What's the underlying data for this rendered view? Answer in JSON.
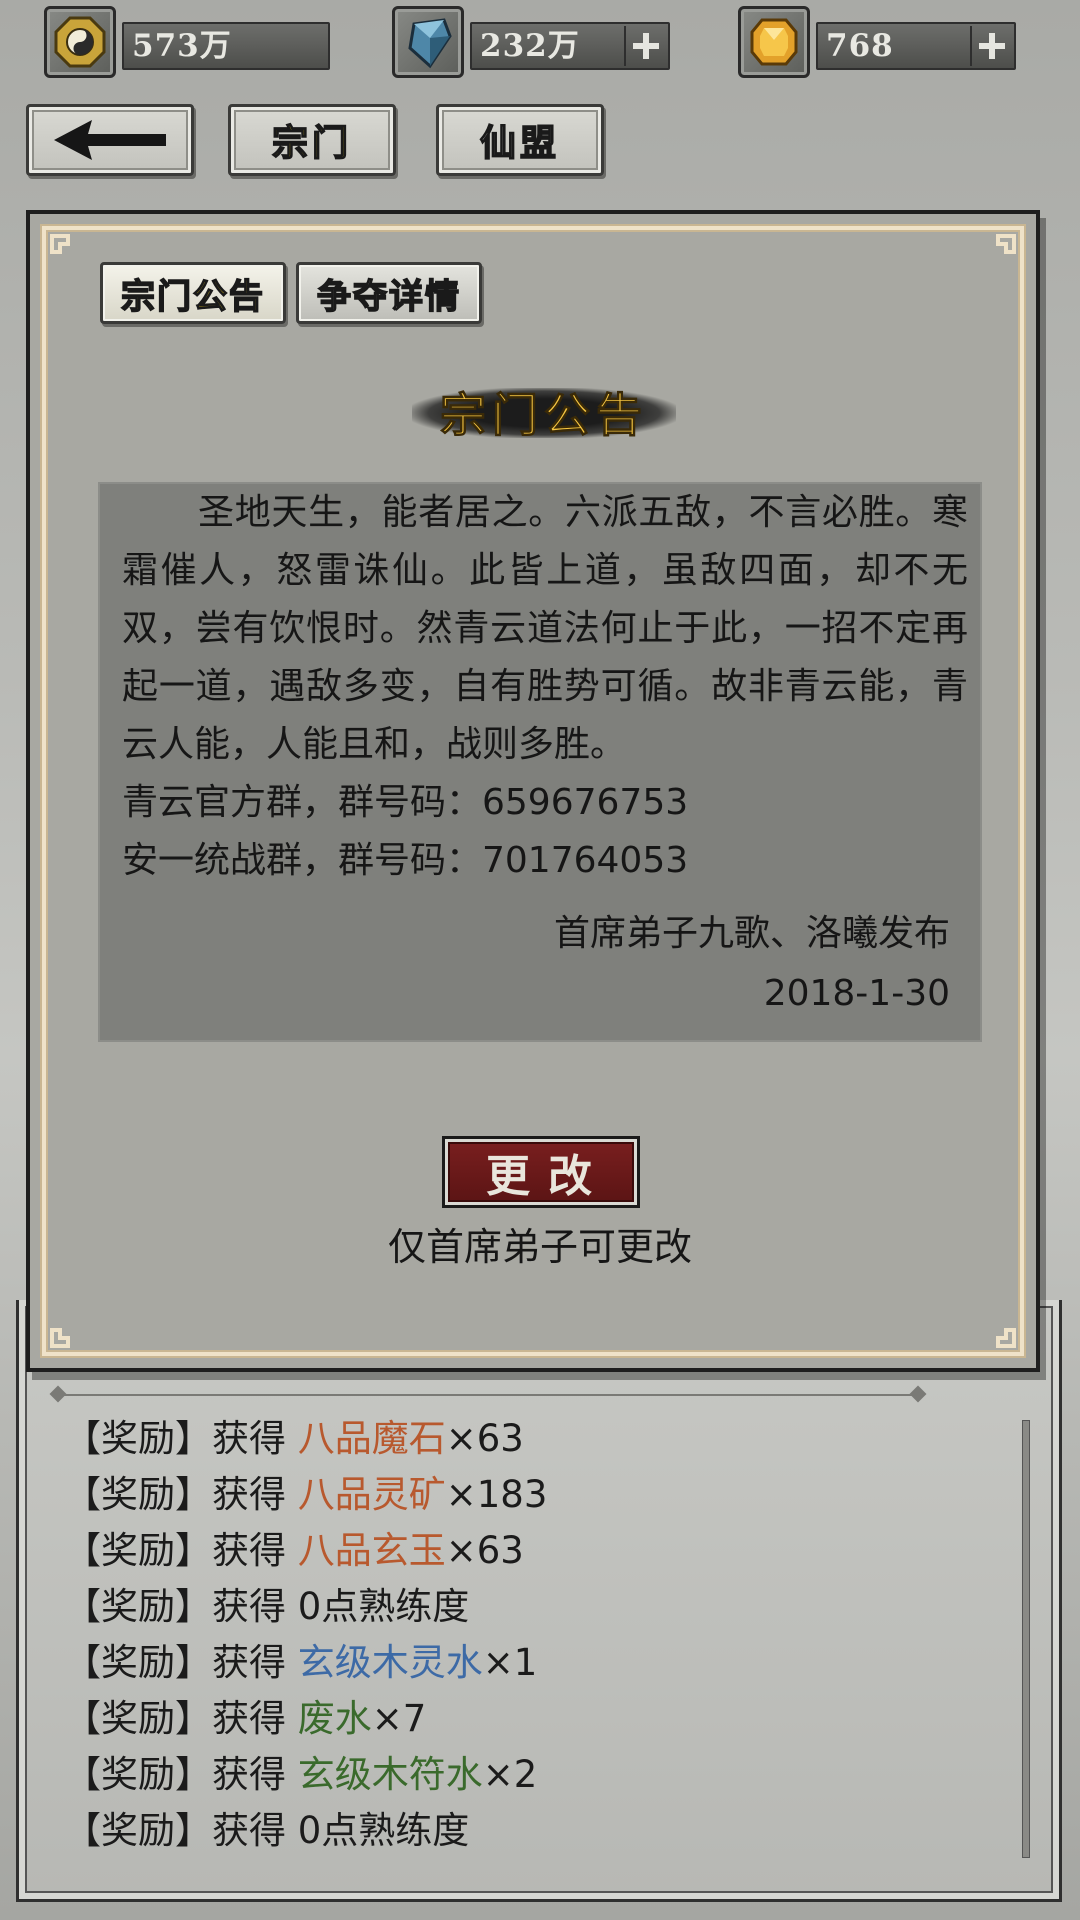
{
  "resources": [
    {
      "icon": "taiji-coin-icon",
      "value": "573万",
      "has_plus": false
    },
    {
      "icon": "spirit-crystal-icon",
      "value": "232万",
      "has_plus": true
    },
    {
      "icon": "gold-gem-icon",
      "value": "768",
      "has_plus": true
    }
  ],
  "nav": {
    "back_icon": "back-arrow-icon",
    "sect_label": "宗门",
    "alliance_label": "仙盟"
  },
  "tabs": [
    {
      "label": "宗门公告",
      "active": true
    },
    {
      "label": "争夺详情",
      "active": false
    }
  ],
  "notice": {
    "title": "宗门公告",
    "paragraph": "圣地天生，能者居之。六派五敌，不言必胜。寒霜催人，怒雷诛仙。此皆上道，虽敌四面，却不无双，尝有饮恨时。然青云道法何止于此，一招不定再起一道，遇敌多变，自有胜势可循。故非青云能，青云人能，人能且和，战则多胜。",
    "line_group1": "青云官方群，群号码：659676753",
    "line_group2": "安一统战群，群号码：701764053",
    "signature": "首席弟子九歌、洛曦发布",
    "date": "2018-1-30"
  },
  "edit": {
    "button_label": "更改",
    "hint": "仅首席弟子可更改"
  },
  "log": [
    {
      "prefix": "【奖励】获得 ",
      "name": "八品魔石",
      "qty": "×63",
      "color": "#b8592e"
    },
    {
      "prefix": "【奖励】获得 ",
      "name": "八品灵矿",
      "qty": "×183",
      "color": "#b8592e"
    },
    {
      "prefix": "【奖励】获得 ",
      "name": "八品玄玉",
      "qty": "×63",
      "color": "#b8592e"
    },
    {
      "prefix": "【奖励】获得 ",
      "name": "0点熟练度",
      "qty": "",
      "color": "#1b1b1b"
    },
    {
      "prefix": "【奖励】获得 ",
      "name": "玄级木灵水",
      "qty": "×1",
      "color": "#3d6aa6"
    },
    {
      "prefix": "【奖励】获得 ",
      "name": "废水",
      "qty": "×7",
      "color": "#3a6a2c"
    },
    {
      "prefix": "【奖励】获得 ",
      "name": "玄级木符水",
      "qty": "×2",
      "color": "#3a6a2c"
    },
    {
      "prefix": "【奖励】获得 ",
      "name": "0点熟练度",
      "qty": "",
      "color": "#1b1b1b"
    }
  ],
  "colors": {
    "title_gold": "#f5c542",
    "tab_active_text": "#f2d21b",
    "edit_button": "#6a1818"
  }
}
